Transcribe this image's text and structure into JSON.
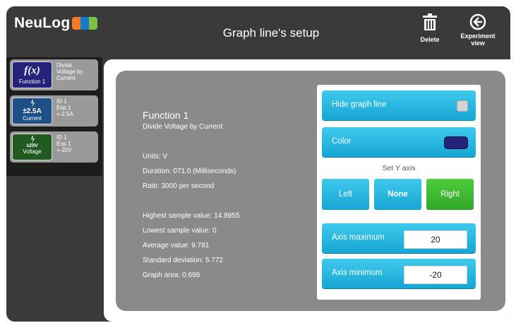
{
  "header": {
    "logo_text": "NeuLog",
    "title": "Graph line's setup",
    "delete_label": "Delete",
    "experiment_label_1": "Experiment",
    "experiment_label_2": "view"
  },
  "sidebar": {
    "items": [
      {
        "symbol": "f(x)",
        "caption": "Function 1",
        "info": [
          "Divide",
          "Voltage by",
          "Current"
        ],
        "color": "#23237a"
      },
      {
        "symbol": "±2.5A",
        "caption": "Current",
        "info": [
          "ID 1",
          "Exp 1",
          "+-2.5A"
        ],
        "color": "#1e4f86"
      },
      {
        "symbol": "±20V",
        "caption": "Voltage",
        "info": [
          "ID 1",
          "Exp 1",
          "+-20V"
        ],
        "color": "#215a21"
      }
    ]
  },
  "details": {
    "title": "Function 1",
    "subtitle": "Divide Voltage by Current",
    "units": "Units: V",
    "duration": "Duration: 071.0 (Milliseconds)",
    "rate": "Rate: 3000 per second",
    "highest": "Highest sample value: 14.8955",
    "lowest": "Lowest sample value: 0",
    "average": "Average value: 9.781",
    "stddev": "Standard deviation: 5.772",
    "area": "Graph area: 0.698"
  },
  "settings": {
    "hide_label": "Hide graph line",
    "color_label": "Color",
    "line_color": "#23237a",
    "set_y_axis": "Set Y axis",
    "left": "Left",
    "none": "None",
    "right": "Right",
    "selected_axis": "Right",
    "axis_max_label": "Axis maximum",
    "axis_max_value": "20",
    "axis_min_label": "Axis minimum",
    "axis_min_value": "-20"
  }
}
